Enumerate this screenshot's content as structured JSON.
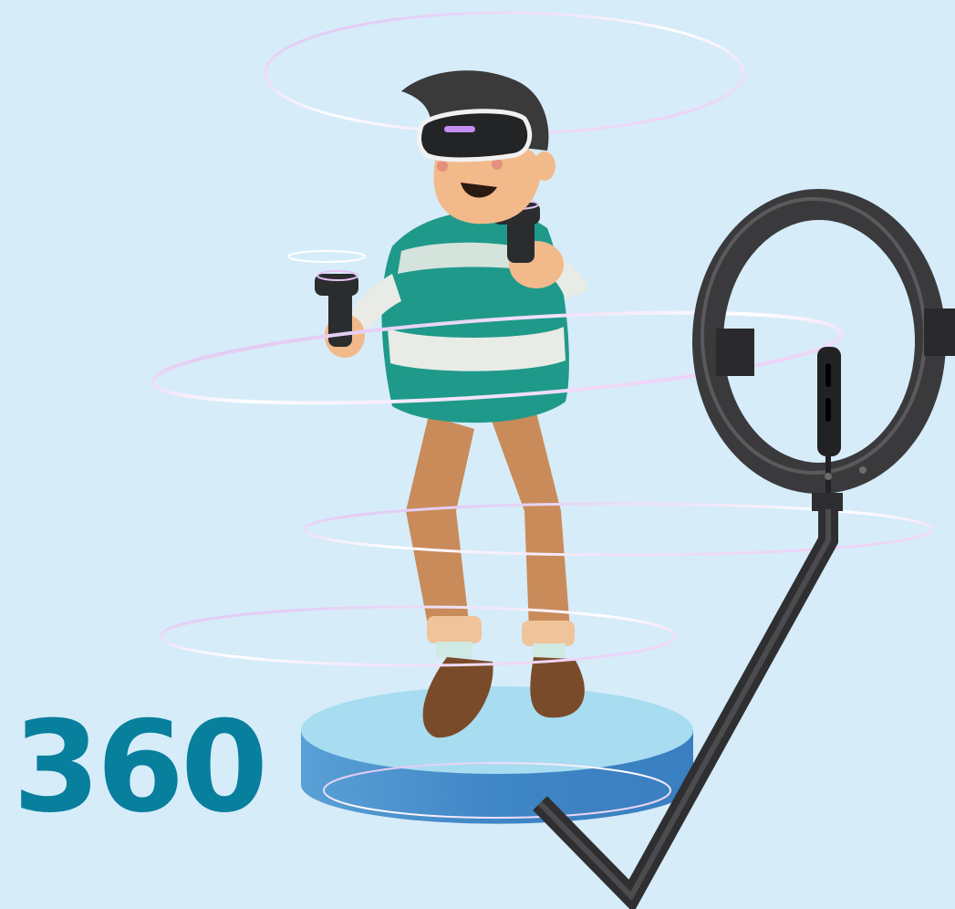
{
  "label": {
    "number_text": "360"
  },
  "colors": {
    "background": "#d6ecf9",
    "number": "#087f9c",
    "platform_top": "#a6dcf1",
    "platform_side": "#4a90cc",
    "ring_light": "#3a3a3c",
    "sweater_green": "#1f9a8a",
    "sweater_stripe": "#e9ebe6",
    "pants": "#c98b5a",
    "shoes": "#7a4b2a",
    "skin": "#f2b98a",
    "hair": "#3a3a3a",
    "vr_headset": "#222426",
    "orbit_rings": "#e8c9f2"
  },
  "icons": {
    "vr_figure": "vr-person-icon",
    "ring_light": "ring-light-icon",
    "platform": "turntable-platform-icon"
  }
}
